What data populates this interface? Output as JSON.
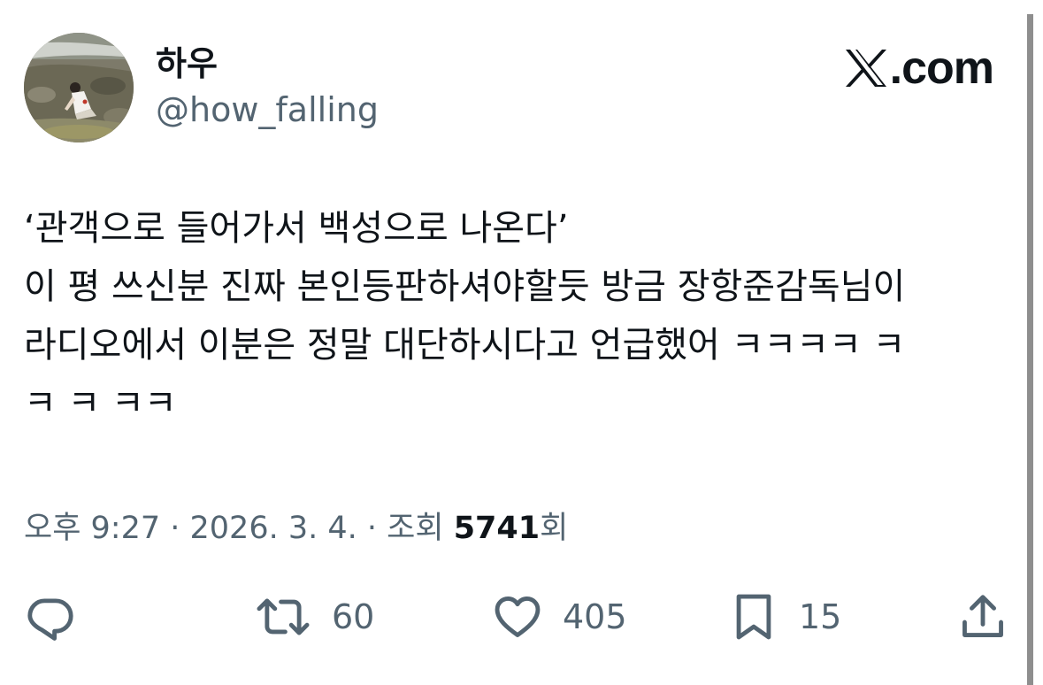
{
  "author": {
    "display_name": "하우",
    "handle": "@how_falling",
    "avatar_icon": "profile-photo"
  },
  "brand": {
    "logo_icon": "x-logo-icon",
    "domain_suffix": ".com"
  },
  "tweet": {
    "lines": [
      "‘관객으로 들어가서 백성으로 나온다’",
      "이 평 쓰신분 진짜 본인등판하셔야할듯 방금 장항준감독님이",
      "라디오에서 이분은 정말 대단하시다고 언급했어 ㅋㅋㅋㅋ ㅋ",
      "ㅋ ㅋ ㅋㅋ"
    ]
  },
  "meta": {
    "time": "오후 9:27",
    "separator": " · ",
    "date": "2026. 3. 4.",
    "views_label": "조회 ",
    "views_count": "5741",
    "views_suffix": "회"
  },
  "actions": {
    "reply": {
      "icon": "reply-icon",
      "count": ""
    },
    "retweet": {
      "icon": "retweet-icon",
      "count": "60"
    },
    "like": {
      "icon": "heart-icon",
      "count": "405"
    },
    "bookmark": {
      "icon": "bookmark-icon",
      "count": "15"
    },
    "share": {
      "icon": "share-icon",
      "count": ""
    }
  },
  "colors": {
    "text_primary": "#0f1419",
    "text_secondary": "#536471",
    "background": "#ffffff"
  }
}
